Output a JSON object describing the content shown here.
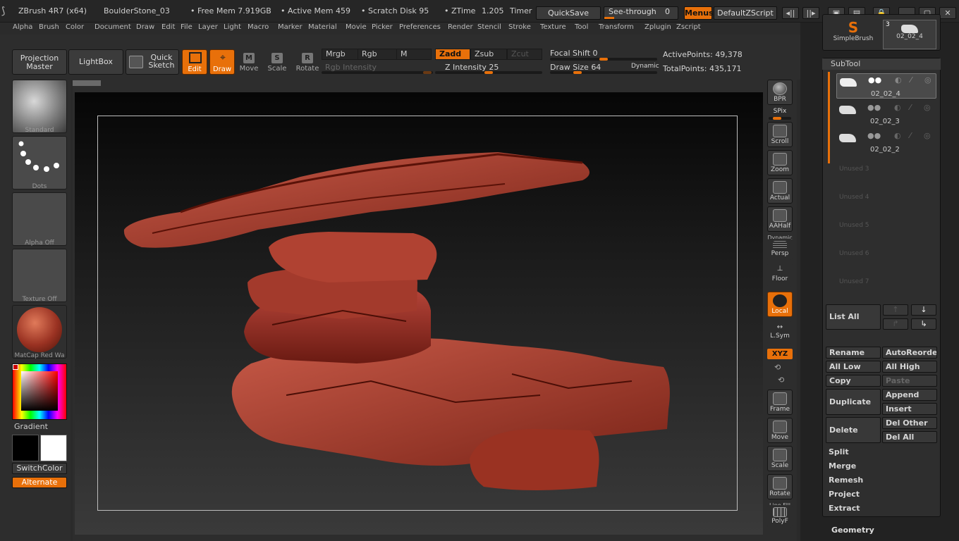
{
  "title": {
    "app": "ZBrush 4R7 (x64)",
    "document": "BoulderStone_03",
    "free_mem": "• Free Mem 7.919GB",
    "active_mem": "• Active Mem 459",
    "scratch": "• Scratch Disk 95",
    "ztime": "• ZTime",
    "ztime_value": "1.205",
    "timer": "Timer",
    "quicksave": "QuickSave",
    "seethrough": "See-through",
    "seethrough_value": "0",
    "menus": "Menus",
    "script": "DefaultZScript"
  },
  "menu": [
    "Alpha",
    "Brush",
    "Color",
    "Document",
    "Draw",
    "Edit",
    "File",
    "Layer",
    "Light",
    "Macro",
    "Marker",
    "Material",
    "Movie",
    "Picker",
    "Preferences",
    "Render",
    "Stencil",
    "Stroke",
    "Texture",
    "Tool",
    "Transform",
    "Zplugin",
    "Zscript"
  ],
  "toolbar": {
    "projection_master": "Projection Master",
    "lightbox": "LightBox",
    "quick_sketch": "Quick Sketch",
    "edit": "Edit",
    "draw": "Draw",
    "move": "Move",
    "scale": "Scale",
    "rotate": "Rotate",
    "mrgb": "Mrgb",
    "rgb": "Rgb",
    "m": "M",
    "rgb_intensity": "Rgb Intensity",
    "zadd": "Zadd",
    "zsub": "Zsub",
    "zcut": "Zcut",
    "z_intensity_label": "Z Intensity",
    "z_intensity": "25",
    "focal_shift_label": "Focal Shift",
    "focal_shift": "0",
    "draw_size_label": "Draw Size",
    "draw_size": "64",
    "dynamic": "Dynamic",
    "active_points_label": "ActivePoints:",
    "active_points": "49,378",
    "total_points_label": "TotalPoints:",
    "total_points": "435,171"
  },
  "left": {
    "brush": "Standard",
    "stroke": "Dots",
    "alpha": "Alpha  Off",
    "texture": "Texture  Off",
    "material": "MatCap  Red  Wa",
    "gradient": "Gradient",
    "switch_color": "SwitchColor",
    "alternate": "Alternate"
  },
  "shelf": {
    "bpr": "BPR",
    "spix": "SPix",
    "scroll": "Scroll",
    "zoom": "Zoom",
    "actual": "Actual",
    "aahalf": "AAHalf",
    "dynamic": "Dynamic",
    "persp": "Persp",
    "floor": "Floor",
    "local": "Local",
    "lsym": "L.Sym",
    "xyz": "XYZ",
    "frame": "Frame",
    "move": "Move",
    "scale": "Scale",
    "rotate": "Rotate",
    "linefill": "Line Fill",
    "polyf": "PolyF"
  },
  "tool": {
    "simple_brush": "SimpleBrush",
    "current_tool": "02_02_4",
    "tool_count": "3"
  },
  "subtool": {
    "header": "SubTool",
    "items": [
      "02_02_4",
      "02_02_3",
      "02_02_2"
    ],
    "unused": [
      "Unused  3",
      "Unused  4",
      "Unused  5",
      "Unused  6",
      "Unused  7"
    ],
    "list_all": "List All",
    "rename": "Rename",
    "auto_reorder": "AutoReorder",
    "all_low": "All Low",
    "all_high": "All High",
    "copy": "Copy",
    "paste": "Paste",
    "duplicate": "Duplicate",
    "append": "Append",
    "insert": "Insert",
    "delete": "Delete",
    "del_other": "Del Other",
    "del_all": "Del All",
    "split": "Split",
    "merge": "Merge",
    "remesh": "Remesh",
    "project": "Project",
    "extract": "Extract",
    "geometry": "Geometry"
  }
}
